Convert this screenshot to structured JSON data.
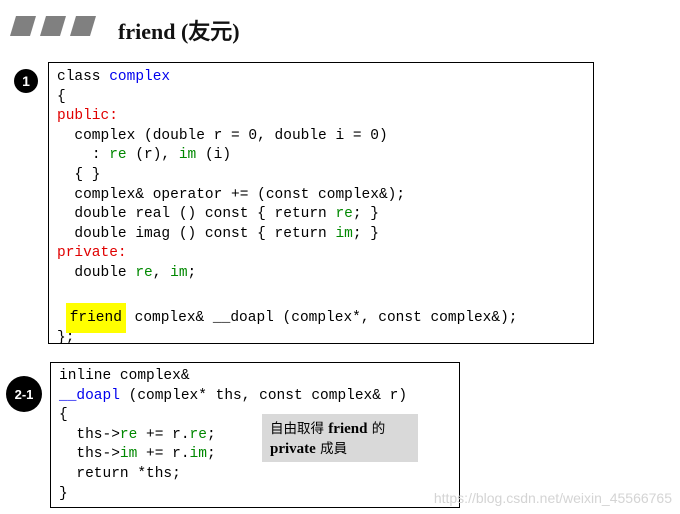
{
  "title": {
    "text": "friend (友元)"
  },
  "badges": {
    "step1": "1",
    "step2": "2-1"
  },
  "code_block_1": {
    "class_kw": "class",
    "class_name": "complex",
    "open_brace": "{",
    "public_label": "public:",
    "ctor_sig": "complex (double r = 0, double i = 0)",
    "init_colon": ": ",
    "init_re": "re",
    "init_re_arg": " (r), ",
    "init_im": "im",
    "init_im_arg": " (i)",
    "empty_body": "{ }",
    "op_decl": "complex& operator += (const complex&);",
    "real_pre": "double real () const { return ",
    "real_member": "re",
    "real_post": "; }",
    "imag_pre": "double imag () const { return ",
    "imag_member": "im",
    "imag_post": "; }",
    "private_label": "private:",
    "fields_type": "double ",
    "field_re": "re",
    "field_sep": ", ",
    "field_im": "im",
    "field_end": ";",
    "friend_kw": "friend",
    "friend_decl": " complex& __doapl (complex*, const complex&);",
    "close_brace": "};"
  },
  "code_block_2": {
    "inline_decl": "inline complex&",
    "func_name": "__doapl",
    "func_params": " (complex* ths, const complex& r)",
    "open_brace": "{",
    "l1_pre": "ths->",
    "l1_member": "re",
    "l1_mid": " += r.",
    "l1_member2": "re",
    "l1_end": ";",
    "l2_pre": "ths->",
    "l2_member": "im",
    "l2_mid": " += r.",
    "l2_member2": "im",
    "l2_end": ";",
    "return_stmt": "return *ths;",
    "close_brace": "}"
  },
  "note": {
    "line1_pre": "自由取得 ",
    "line1_bold": "friend",
    "line1_post": " 的",
    "line2_bold": "private",
    "line2_post": " 成員"
  },
  "watermark": {
    "text": "https://blog.csdn.net/weixin_45566765"
  },
  "colors": {
    "keyword_blue": "#0000ee",
    "keyword_red": "#e00000",
    "member_green": "#008800",
    "highlight_yellow": "#ffff00",
    "note_bg": "#d9d9d9",
    "stripe_gray": "#808080"
  }
}
